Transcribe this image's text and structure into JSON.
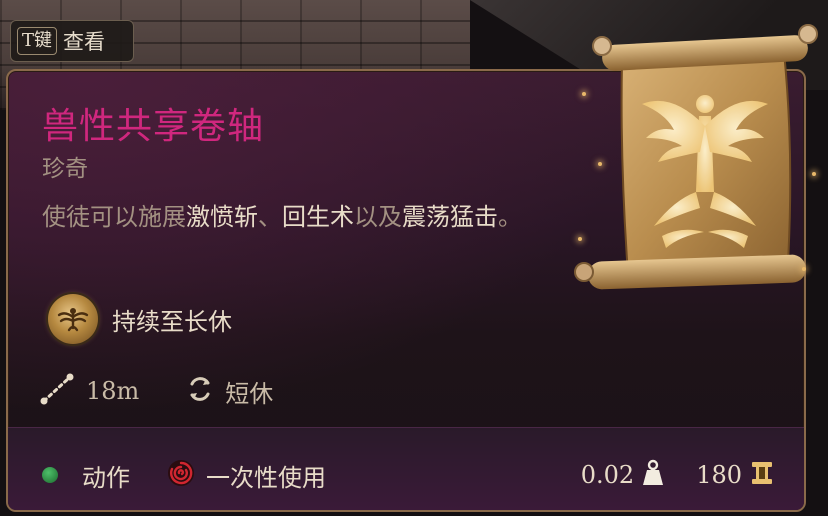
{
  "hint": {
    "key": "T键",
    "label": "查看"
  },
  "item": {
    "name": "兽性共享卷轴",
    "rarity": "珍奇",
    "description": {
      "part1": "使徒可以施展",
      "spell1": "激愤斩",
      "sep": "、",
      "spell2": "回生术",
      "part2": "以及",
      "spell3": "震荡猛击",
      "end": "。"
    },
    "duration": "持续至长休",
    "range": "18m",
    "recharge": "短休",
    "action_type": "动作",
    "usage": "一次性使用",
    "weight": "0.02",
    "value": "180"
  },
  "colors": {
    "title": "#d0277e",
    "rarity": "#a39182",
    "highlight": "#e8dcc8",
    "action_dot": "#2fa34a",
    "usage_icon": "#c0202a",
    "gold": "#e8c070"
  },
  "icons": {
    "medallion": "winged-figure-medallion-icon",
    "range": "range-dotted-line-icon",
    "recharge": "rest-cycle-icon",
    "action": "action-dot-icon",
    "usage": "single-use-swirl-icon",
    "weight": "weight-icon",
    "value": "gold-coin-icon",
    "illustration": "scroll-illustration"
  }
}
